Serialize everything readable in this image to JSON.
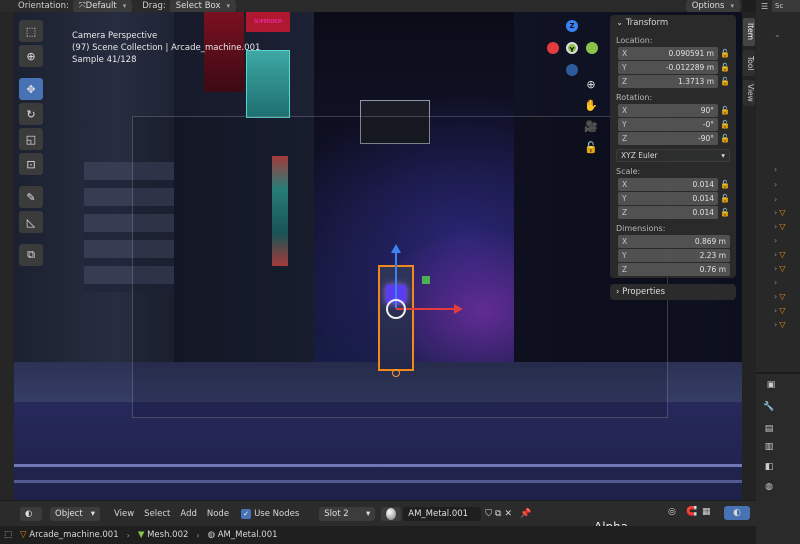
{
  "header": {
    "orientation_label": "Orientation:",
    "orientation_value": "Default",
    "drag_label": "Drag:",
    "drag_value": "Select Box",
    "options_label": "Options"
  },
  "viewport": {
    "info_line1": "Camera Perspective",
    "info_line2": "(97) Scene Collection | Arcade_machine.001",
    "info_line3": "Sample 41/128",
    "sign_text": "SUPERDRIP"
  },
  "transform_panel": {
    "title": "Transform",
    "location_label": "Location:",
    "location": [
      {
        "axis": "X",
        "value": "0.090591 m"
      },
      {
        "axis": "Y",
        "value": "-0.012289 m"
      },
      {
        "axis": "Z",
        "value": "1.3713 m"
      }
    ],
    "rotation_label": "Rotation:",
    "rotation": [
      {
        "axis": "X",
        "value": "90°"
      },
      {
        "axis": "Y",
        "value": "-0°"
      },
      {
        "axis": "Z",
        "value": "-90°"
      }
    ],
    "rotation_mode": "XYZ Euler",
    "scale_label": "Scale:",
    "scale": [
      {
        "axis": "X",
        "value": "0.014"
      },
      {
        "axis": "Y",
        "value": "0.014"
      },
      {
        "axis": "Z",
        "value": "0.014"
      }
    ],
    "dimensions_label": "Dimensions:",
    "dimensions": [
      {
        "axis": "X",
        "value": "0.869 m"
      },
      {
        "axis": "Y",
        "value": "2.23 m"
      },
      {
        "axis": "Z",
        "value": "0.76 m"
      }
    ],
    "properties_label": "Properties"
  },
  "n_tabs": {
    "item": "Item",
    "tool": "Tool",
    "view": "View"
  },
  "outliner": {
    "tab_label": "Sc"
  },
  "node_header": {
    "mode_value": "Object",
    "menu_view": "View",
    "menu_select": "Select",
    "menu_add": "Add",
    "menu_node": "Node",
    "use_nodes_label": "Use Nodes",
    "slot_value": "Slot 2",
    "material_name": "AM_Metal.001"
  },
  "breadcrumb": {
    "object": "Arcade_machine.001",
    "mesh": "Mesh.002",
    "material": "AM_Metal.001"
  },
  "alpha_label": "Alpha",
  "gizmo": {
    "x": "X",
    "y": "Y",
    "z": "Z"
  }
}
